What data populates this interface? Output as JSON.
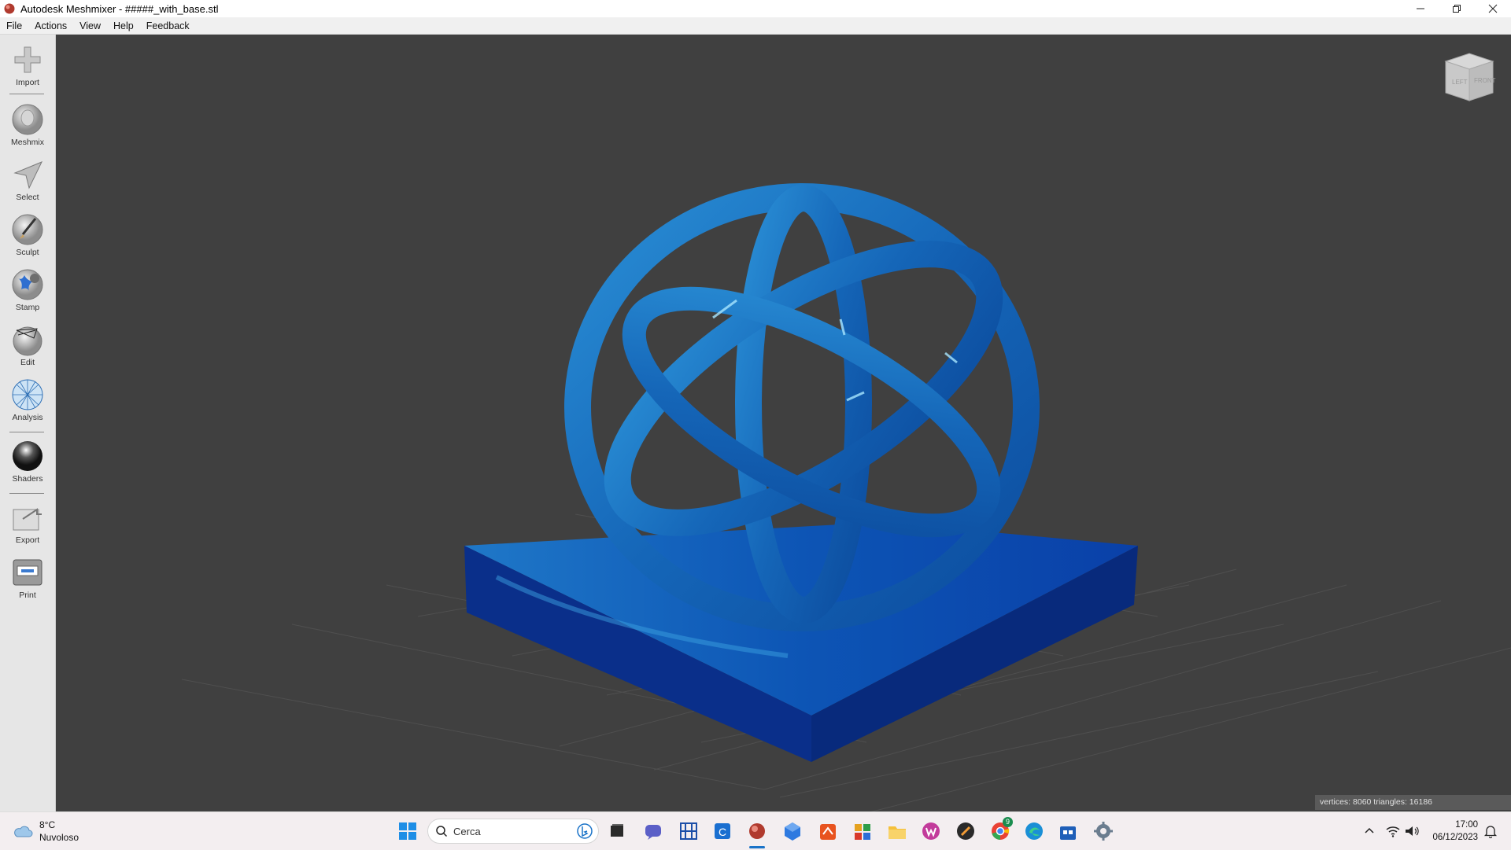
{
  "window": {
    "title": "Autodesk Meshmixer - #####_with_base.stl",
    "minimize_icon": "minimize-icon",
    "restore_icon": "restore-icon",
    "close_icon": "close-icon"
  },
  "menu": {
    "items": [
      "File",
      "Actions",
      "View",
      "Help",
      "Feedback"
    ]
  },
  "toolbar": {
    "tools": [
      {
        "label": "Import",
        "icon": "import-plus-icon"
      },
      {
        "label": "Meshmix",
        "icon": "meshmix-bust-icon"
      },
      {
        "label": "Select",
        "icon": "select-arrow-icon"
      },
      {
        "label": "Sculpt",
        "icon": "sculpt-brush-icon"
      },
      {
        "label": "Stamp",
        "icon": "stamp-icon"
      },
      {
        "label": "Edit",
        "icon": "edit-sphere-icon"
      },
      {
        "label": "Analysis",
        "icon": "analysis-sphere-icon"
      },
      {
        "label": "Shaders",
        "icon": "shaders-sphere-icon"
      },
      {
        "label": "Export",
        "icon": "export-folder-icon"
      },
      {
        "label": "Print",
        "icon": "printer-icon"
      }
    ]
  },
  "viewport": {
    "viewcube": {
      "left": "LEFT",
      "front": "FRONT"
    },
    "status": "vertices: 8060 triangles: 16186",
    "colors": {
      "background": "#404040",
      "model": "#1a6fc0",
      "base": "#0a3fa8"
    }
  },
  "taskbar": {
    "weather": {
      "temp": "8°C",
      "condition": "Nuvoloso"
    },
    "search_placeholder": "Cerca",
    "clock": {
      "time": "17:00",
      "date": "06/12/2023"
    },
    "chrome_badge": "9"
  }
}
